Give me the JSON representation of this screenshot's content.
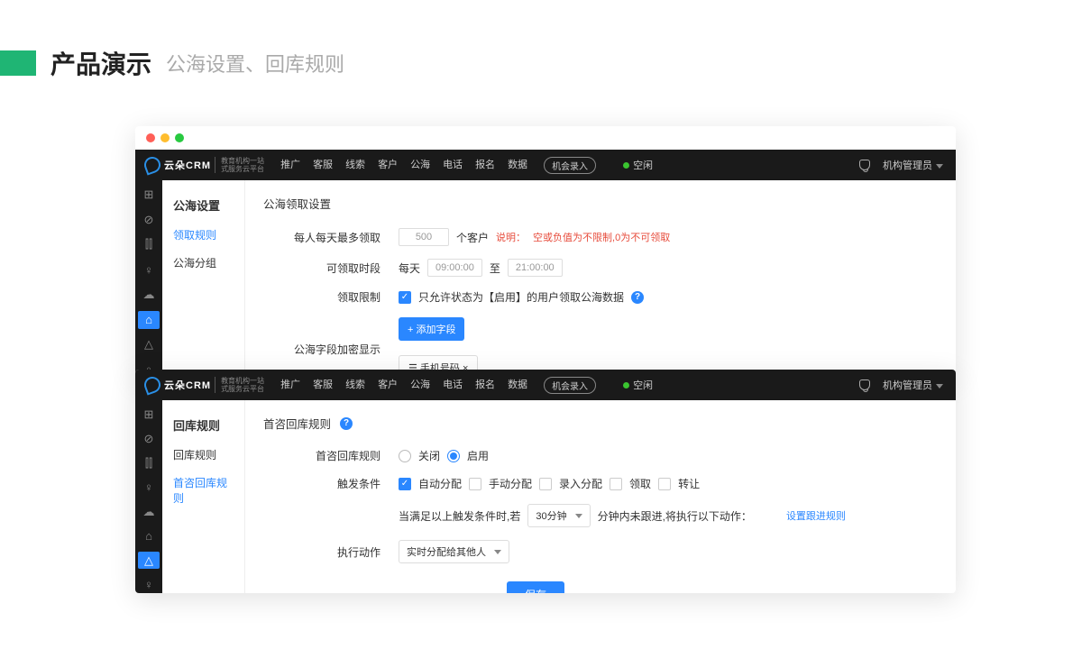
{
  "slide": {
    "title": "产品演示",
    "subtitle": "公海设置、回库规则"
  },
  "logo": {
    "brand": "云朵CRM",
    "tag1": "教育机构一站",
    "tag2": "式服务云平台"
  },
  "nav": {
    "items": [
      "推广",
      "客服",
      "线索",
      "客户",
      "公海",
      "电话",
      "报名",
      "数据"
    ],
    "pill": "机会录入",
    "status": "空闲",
    "user": "机构管理员"
  },
  "shot1": {
    "menuTitle": "公海设置",
    "menuItems": [
      "领取规则",
      "公海分组"
    ],
    "activeIdx": 0,
    "contentTitle": "公海领取设置",
    "row1": {
      "label": "每人每天最多领取",
      "value": "500",
      "suffix": "个客户",
      "hintPre": "说明：",
      "hint": "空或负值为不限制,0为不可领取"
    },
    "row2": {
      "label": "可领取时段",
      "prefix": "每天",
      "from": "09:00:00",
      "to": "21:00:00",
      "sep": "至"
    },
    "row3": {
      "label": "领取限制",
      "text": "只允许状态为【启用】的用户领取公海数据"
    },
    "row4": {
      "label": "公海字段加密显示",
      "btn": "+ 添加字段",
      "tag": "☰ 手机号码 ×"
    }
  },
  "shot2": {
    "menuTitle": "回库规则",
    "menuItems": [
      "回库规则",
      "首咨回库规则"
    ],
    "activeIdx": 1,
    "contentTitle": "首咨回库规则",
    "row1": {
      "label": "首咨回库规则",
      "off": "关闭",
      "on": "启用"
    },
    "row2": {
      "label": "触发条件",
      "opts": [
        "自动分配",
        "手动分配",
        "录入分配",
        "领取",
        "转让"
      ],
      "checkedIdx": 0
    },
    "row3": {
      "pre": "当满足以上触发条件时,若",
      "sel": "30分钟",
      "mid": "分钟内未跟进,将执行以下动作：",
      "link": "设置跟进规则"
    },
    "row4": {
      "label": "执行动作",
      "sel": "实时分配给其他人"
    },
    "save": "保存"
  }
}
